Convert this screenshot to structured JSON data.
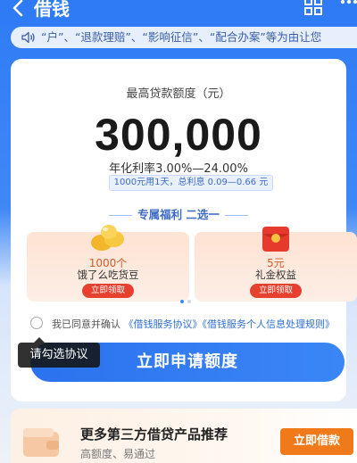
{
  "header": {
    "title": "借钱"
  },
  "notice": {
    "text": "“户”、“退款理赔”、“影响征信”、“配合办案”等为由让您"
  },
  "loan": {
    "limit_label": "最高贷款额度（元）",
    "amount": "300,000",
    "rate": "年化利率3.00%—24.00%",
    "interest_note": "1000元用1天，总利息 0.09—0.66 元"
  },
  "benefits": {
    "title": "专属福利 二选一",
    "items": [
      {
        "amount": "1000个",
        "desc": "饿了么吃货豆",
        "button": "立即领取"
      },
      {
        "amount": "5元",
        "desc": "礼金权益",
        "button": "立即领取"
      }
    ]
  },
  "agreement": {
    "prefix": "我已同意并确认",
    "link1": "《借钱服务协议》",
    "link2": "《借钱服务个人信息处理规则》"
  },
  "tooltip": {
    "text": "请勾选协议"
  },
  "apply_button": {
    "label": "立即申请额度"
  },
  "promo": {
    "title": "更多第三方借贷产品推荐",
    "subtitle": "高额度、易通过",
    "button": "立即借款"
  },
  "colors": {
    "primary": "#2f7bf5",
    "accent_red": "#e6402f",
    "accent_orange": "#f07a1a",
    "link": "#2f6fd8"
  },
  "icons": [
    "back-icon",
    "scan-icon",
    "more-icon",
    "speaker-icon",
    "beans-icon",
    "red-packet-icon",
    "wallet-icon"
  ]
}
